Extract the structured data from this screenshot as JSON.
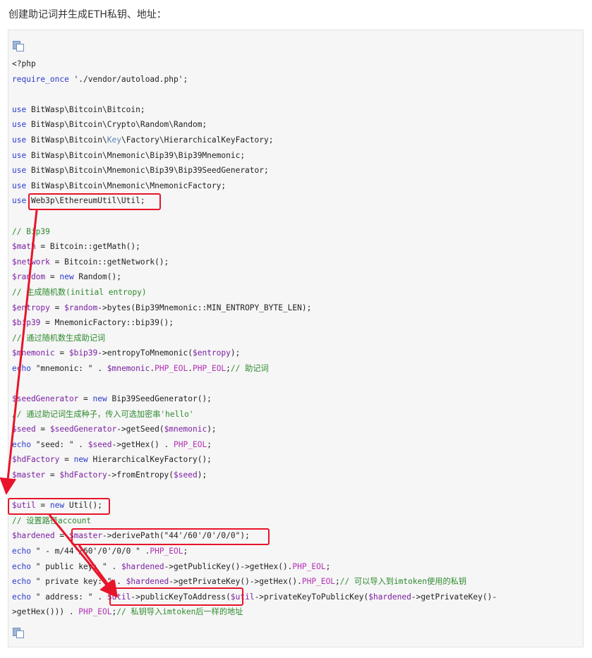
{
  "heading": "创建助记词并生成ETH私钥、地址：",
  "colors": {
    "keyword": "#2a3bcc",
    "variable": "#7a1fa2",
    "constant": "#b231b3",
    "comment": "#2d8a2d",
    "highlight": "#e8142a"
  },
  "icons": {
    "copy": "copy-code-icon"
  },
  "code": [
    [
      [
        "t",
        "<?php"
      ]
    ],
    [
      [
        "kw",
        "require_once"
      ],
      [
        "t",
        " './vendor/autoload.php';"
      ]
    ],
    [],
    [
      [
        "kw",
        "use"
      ],
      [
        "t",
        " BitWasp\\Bitcoin\\Bitcoin;"
      ]
    ],
    [
      [
        "kw",
        "use"
      ],
      [
        "t",
        " BitWasp\\Bitcoin\\Crypto\\Random\\Random;"
      ]
    ],
    [
      [
        "kw",
        "use"
      ],
      [
        "t",
        " BitWasp\\Bitcoin\\"
      ],
      [
        "ns2",
        "Key"
      ],
      [
        "t",
        "\\Factory\\HierarchicalKeyFactory;"
      ]
    ],
    [
      [
        "kw",
        "use"
      ],
      [
        "t",
        " BitWasp\\Bitcoin\\Mnemonic\\Bip39\\Bip39Mnemonic;"
      ]
    ],
    [
      [
        "kw",
        "use"
      ],
      [
        "t",
        " BitWasp\\Bitcoin\\Mnemonic\\Bip39\\Bip39SeedGenerator;"
      ]
    ],
    [
      [
        "kw",
        "use"
      ],
      [
        "t",
        " BitWasp\\Bitcoin\\Mnemonic\\MnemonicFactory;"
      ]
    ],
    [
      [
        "kw",
        "use"
      ],
      [
        "t",
        " Web3p\\EthereumUtil\\Util;"
      ]
    ],
    [],
    [
      [
        "cm",
        "// Bip39"
      ]
    ],
    [
      [
        "var",
        "$math"
      ],
      [
        "t",
        " = Bitcoin::getMath();"
      ]
    ],
    [
      [
        "var",
        "$network"
      ],
      [
        "t",
        " = Bitcoin::getNetwork();"
      ]
    ],
    [
      [
        "var",
        "$random"
      ],
      [
        "t",
        " = "
      ],
      [
        "kw",
        "new"
      ],
      [
        "t",
        " Random();"
      ]
    ],
    [
      [
        "cm",
        "// 生成随机数(initial entropy)"
      ]
    ],
    [
      [
        "var",
        "$entropy"
      ],
      [
        "t",
        " = "
      ],
      [
        "var",
        "$random"
      ],
      [
        "t",
        "->bytes(Bip39Mnemonic::MIN_ENTROPY_BYTE_LEN);"
      ]
    ],
    [
      [
        "var",
        "$bip39"
      ],
      [
        "t",
        " = MnemonicFactory::bip39();"
      ]
    ],
    [
      [
        "cm",
        "// 通过随机数生成助记词"
      ]
    ],
    [
      [
        "var",
        "$mnemonic"
      ],
      [
        "t",
        " = "
      ],
      [
        "var",
        "$bip39"
      ],
      [
        "t",
        "->entropyToMnemonic("
      ],
      [
        "var",
        "$entropy"
      ],
      [
        "t",
        ");"
      ]
    ],
    [
      [
        "kw",
        "echo"
      ],
      [
        "t",
        " \"mnemonic: \" . "
      ],
      [
        "var",
        "$mnemonic"
      ],
      [
        "t",
        "."
      ],
      [
        "const",
        "PHP_EOL"
      ],
      [
        "t",
        "."
      ],
      [
        "const",
        "PHP_EOL"
      ],
      [
        "t",
        ";"
      ],
      [
        "cm",
        "// 助记词"
      ]
    ],
    [],
    [
      [
        "var",
        "$seedGenerator"
      ],
      [
        "t",
        " = "
      ],
      [
        "kw",
        "new"
      ],
      [
        "t",
        " Bip39SeedGenerator();"
      ]
    ],
    [
      [
        "cm",
        "// 通过助记词生成种子，传入可选加密串'hello'"
      ]
    ],
    [
      [
        "var",
        "$seed"
      ],
      [
        "t",
        " = "
      ],
      [
        "var",
        "$seedGenerator"
      ],
      [
        "t",
        "->getSeed("
      ],
      [
        "var",
        "$mnemonic"
      ],
      [
        "t",
        ");"
      ]
    ],
    [
      [
        "kw",
        "echo"
      ],
      [
        "t",
        " \"seed: \" . "
      ],
      [
        "var",
        "$seed"
      ],
      [
        "t",
        "->getHex() . "
      ],
      [
        "const",
        "PHP_EOL"
      ],
      [
        "t",
        ";"
      ]
    ],
    [
      [
        "var",
        "$hdFactory"
      ],
      [
        "t",
        " = "
      ],
      [
        "kw",
        "new"
      ],
      [
        "t",
        " HierarchicalKeyFactory();"
      ]
    ],
    [
      [
        "var",
        "$master"
      ],
      [
        "t",
        " = "
      ],
      [
        "var",
        "$hdFactory"
      ],
      [
        "t",
        "->fromEntropy("
      ],
      [
        "var",
        "$seed"
      ],
      [
        "t",
        ");"
      ]
    ],
    [],
    [
      [
        "var",
        "$util"
      ],
      [
        "t",
        " = "
      ],
      [
        "kw",
        "new"
      ],
      [
        "t",
        " Util();"
      ]
    ],
    [
      [
        "cm",
        "// 设置路径account"
      ]
    ],
    [
      [
        "var",
        "$hardened"
      ],
      [
        "t",
        " = "
      ],
      [
        "var",
        "$master"
      ],
      [
        "t",
        "->derivePath(\"44'/60'/0'/0/0\");"
      ]
    ],
    [
      [
        "kw",
        "echo"
      ],
      [
        "t",
        " \" - m/44'/60'/0'/0/0 \" ."
      ],
      [
        "const",
        "PHP_EOL"
      ],
      [
        "t",
        ";"
      ]
    ],
    [
      [
        "kw",
        "echo"
      ],
      [
        "t",
        " \" public key: \" . "
      ],
      [
        "var",
        "$hardened"
      ],
      [
        "t",
        "->getPublicKey()->getHex()."
      ],
      [
        "const",
        "PHP_EOL"
      ],
      [
        "t",
        ";"
      ]
    ],
    [
      [
        "kw",
        "echo"
      ],
      [
        "t",
        " \" private key: \" . "
      ],
      [
        "var",
        "$hardened"
      ],
      [
        "t",
        "->getPrivateKey()->getHex()."
      ],
      [
        "const",
        "PHP_EOL"
      ],
      [
        "t",
        ";"
      ],
      [
        "cm",
        "// 可以导入到imtoken使用的私钥"
      ]
    ],
    [
      [
        "kw",
        "echo"
      ],
      [
        "t",
        " \" address: \" . "
      ],
      [
        "var",
        "$util"
      ],
      [
        "t",
        "->publicKeyToAddress("
      ],
      [
        "var",
        "$util"
      ],
      [
        "t",
        "->privateKeyToPublicKey("
      ],
      [
        "var",
        "$hardened"
      ],
      [
        "t",
        "->getPrivateKey()-"
      ]
    ],
    [
      [
        "t",
        ">getHex())) . "
      ],
      [
        "const",
        "PHP_EOL"
      ],
      [
        "t",
        ";"
      ],
      [
        "cm",
        "// 私钥导入imtoken后一样的地址"
      ]
    ]
  ]
}
